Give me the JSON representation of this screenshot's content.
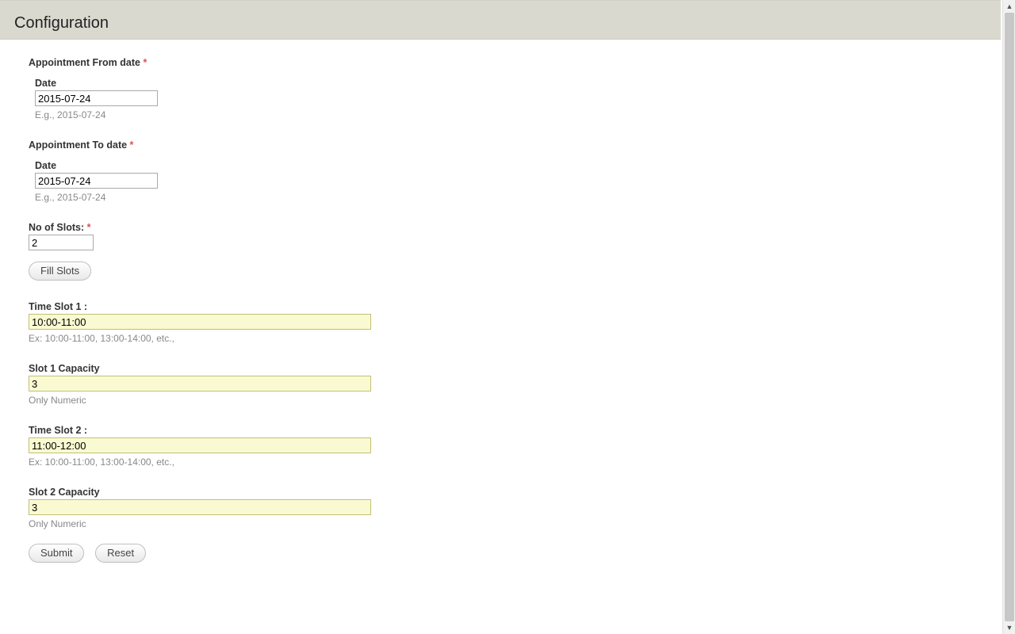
{
  "header": {
    "title": "Configuration"
  },
  "fromDate": {
    "label": "Appointment From date",
    "dateLabel": "Date",
    "value": "2015-07-24",
    "hint": "E.g., 2015-07-24"
  },
  "toDate": {
    "label": "Appointment To date",
    "dateLabel": "Date",
    "value": "2015-07-24",
    "hint": "E.g., 2015-07-24"
  },
  "slots": {
    "label": "No of Slots:",
    "value": "2",
    "fillButton": "Fill Slots"
  },
  "timeSlot1": {
    "label": "Time Slot 1 :",
    "value": "10:00-11:00",
    "hint": "Ex: 10:00-11:00, 13:00-14:00, etc.,"
  },
  "cap1": {
    "label": "Slot 1 Capacity",
    "value": "3",
    "hint": "Only Numeric"
  },
  "timeSlot2": {
    "label": "Time Slot 2 :",
    "value": "11:00-12:00",
    "hint": "Ex: 10:00-11:00, 13:00-14:00, etc.,"
  },
  "cap2": {
    "label": "Slot 2 Capacity",
    "value": "3",
    "hint": "Only Numeric"
  },
  "actions": {
    "submit": "Submit",
    "reset": "Reset"
  }
}
